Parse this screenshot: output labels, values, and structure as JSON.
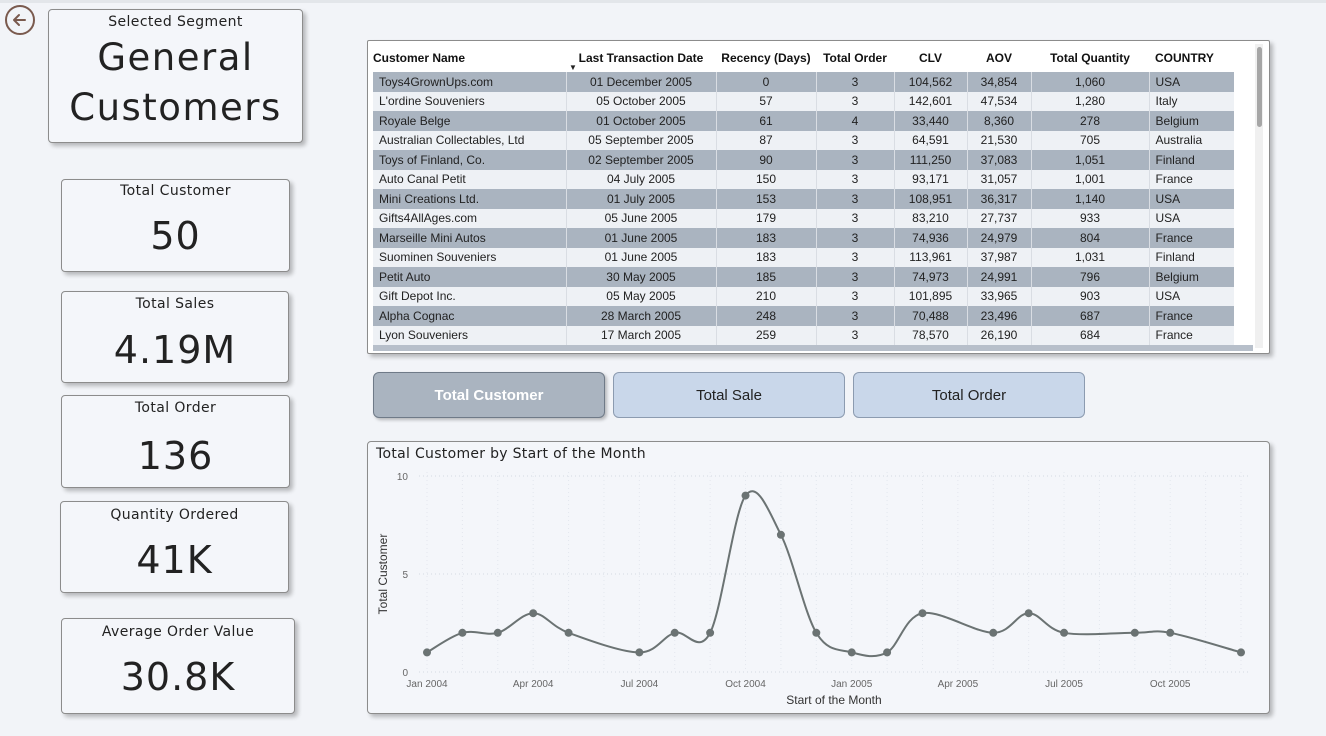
{
  "segment": {
    "label": "Selected Segment",
    "line1": "General",
    "line2": "Customers"
  },
  "kpis": {
    "total_customer": {
      "label": "Total Customer",
      "value": "50"
    },
    "total_sales": {
      "label": "Total Sales",
      "value": "4.19M"
    },
    "total_order": {
      "label": "Total Order",
      "value": "136"
    },
    "quantity_ordered": {
      "label": "Quantity Ordered",
      "value": "41K"
    },
    "avg_order_value": {
      "label": "Average Order Value",
      "value": "30.8K"
    }
  },
  "table": {
    "headers": [
      "Customer Name",
      "Last Transaction Date",
      "Recency (Days)",
      "Total Order",
      "CLV",
      "AOV",
      "Total Quantity",
      "COUNTRY"
    ],
    "rows": [
      [
        "Toys4GrownUps.com",
        "01 December 2005",
        "0",
        "3",
        "104,562",
        "34,854",
        "1,060",
        "USA"
      ],
      [
        "L'ordine Souveniers",
        "05 October 2005",
        "57",
        "3",
        "142,601",
        "47,534",
        "1,280",
        "Italy"
      ],
      [
        "Royale Belge",
        "01 October 2005",
        "61",
        "4",
        "33,440",
        "8,360",
        "278",
        "Belgium"
      ],
      [
        "Australian Collectables, Ltd",
        "05 September 2005",
        "87",
        "3",
        "64,591",
        "21,530",
        "705",
        "Australia"
      ],
      [
        "Toys of Finland, Co.",
        "02 September 2005",
        "90",
        "3",
        "111,250",
        "37,083",
        "1,051",
        "Finland"
      ],
      [
        "Auto Canal Petit",
        "04 July 2005",
        "150",
        "3",
        "93,171",
        "31,057",
        "1,001",
        "France"
      ],
      [
        "Mini Creations Ltd.",
        "01 July 2005",
        "153",
        "3",
        "108,951",
        "36,317",
        "1,140",
        "USA"
      ],
      [
        "Gifts4AllAges.com",
        "05 June 2005",
        "179",
        "3",
        "83,210",
        "27,737",
        "933",
        "USA"
      ],
      [
        "Marseille Mini Autos",
        "01 June 2005",
        "183",
        "3",
        "74,936",
        "24,979",
        "804",
        "France"
      ],
      [
        "Suominen Souveniers",
        "01 June 2005",
        "183",
        "3",
        "113,961",
        "37,987",
        "1,031",
        "Finland"
      ],
      [
        "Petit Auto",
        "30 May 2005",
        "185",
        "3",
        "74,973",
        "24,991",
        "796",
        "Belgium"
      ],
      [
        "Gift Depot Inc.",
        "05 May 2005",
        "210",
        "3",
        "101,895",
        "33,965",
        "903",
        "USA"
      ],
      [
        "Alpha Cognac",
        "28 March 2005",
        "248",
        "3",
        "70,488",
        "23,496",
        "687",
        "France"
      ],
      [
        "Lyon Souveniers",
        "17 March 2005",
        "259",
        "3",
        "78,570",
        "26,190",
        "684",
        "France"
      ]
    ]
  },
  "buttons": {
    "total_customer": "Total Customer",
    "total_sale": "Total Sale",
    "total_order": "Total Order"
  },
  "chart_data": {
    "type": "line",
    "title": "Total Customer by Start of the Month",
    "xlabel": "Start of the Month",
    "ylabel": "Total Customer",
    "ylim": [
      0,
      10
    ],
    "yticks": [
      "0",
      "5",
      "10"
    ],
    "xtick_labels": [
      "Jan 2004",
      "Apr 2004",
      "Jul 2004",
      "Oct 2004",
      "Jan 2005",
      "Apr 2005",
      "Jul 2005",
      "Oct 2005"
    ],
    "x": [
      "2004-01",
      "2004-02",
      "2004-03",
      "2004-04",
      "2004-05",
      "2004-07",
      "2004-08",
      "2004-09",
      "2004-10",
      "2004-11",
      "2004-12",
      "2005-01",
      "2005-02",
      "2005-03",
      "2005-05",
      "2005-06",
      "2005-07",
      "2005-09",
      "2005-10",
      "2005-12"
    ],
    "values": [
      1,
      2,
      2,
      3,
      2,
      1,
      2,
      2,
      9,
      7,
      2,
      1,
      1,
      3,
      2,
      3,
      2,
      2,
      2,
      1
    ],
    "line_color": "#6b7373",
    "grid": true
  }
}
